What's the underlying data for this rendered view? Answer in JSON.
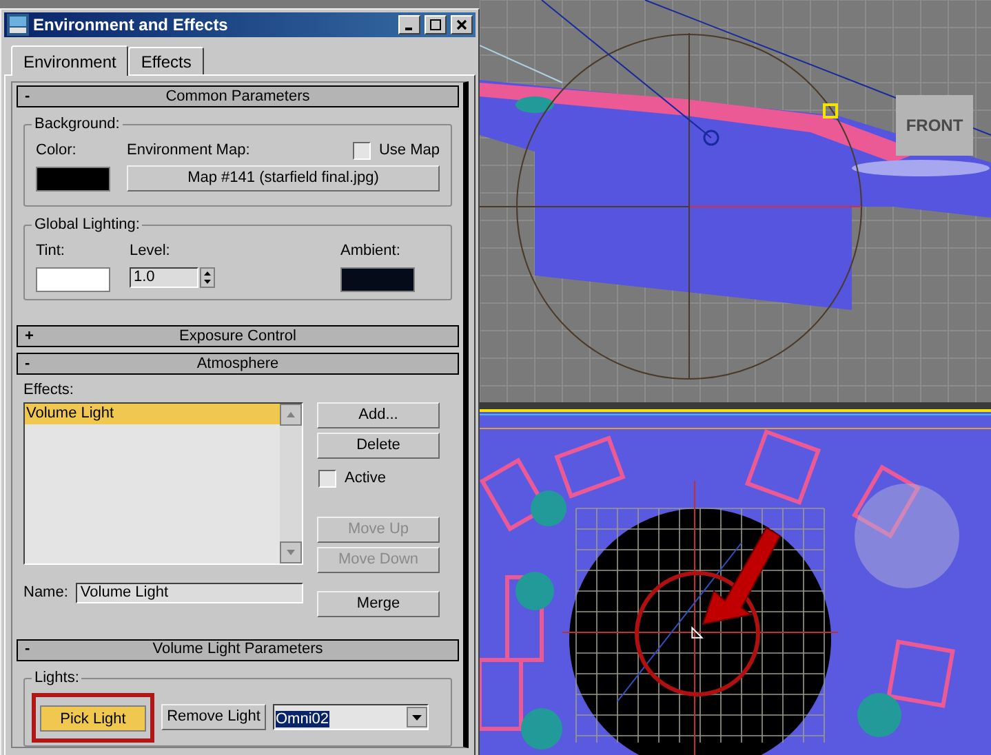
{
  "window": {
    "title": "Environment and Effects"
  },
  "tabs": [
    {
      "label": "Environment",
      "selected": true
    },
    {
      "label": "Effects",
      "selected": false
    }
  ],
  "common_parameters": {
    "toggle": "-",
    "title": "Common Parameters",
    "background": {
      "label": "Background:",
      "color_label": "Color:",
      "env_map_label": "Environment Map:",
      "use_map": {
        "label": "Use Map",
        "checked": false
      },
      "map_button": "Map #141 (starfield final.jpg)"
    },
    "global_lighting": {
      "label": "Global Lighting:",
      "tint_label": "Tint:",
      "level_label": "Level:",
      "level_value": "1.0",
      "ambient_label": "Ambient:"
    }
  },
  "exposure_control": {
    "toggle": "+",
    "title": "Exposure Control"
  },
  "atmosphere": {
    "toggle": "-",
    "title": "Atmosphere",
    "effects_label": "Effects:",
    "effects": [
      {
        "label": "Volume Light",
        "selected": true
      }
    ],
    "top_buttons": [
      {
        "label": "Add...",
        "disabled": false
      },
      {
        "label": "Delete",
        "disabled": false
      }
    ],
    "active": {
      "label": "Active",
      "checked": false
    },
    "move_buttons": [
      {
        "label": "Move Up",
        "disabled": true
      },
      {
        "label": "Move Down",
        "disabled": true
      }
    ],
    "name_label": "Name:",
    "name_value": "Volume Light",
    "merge_button": "Merge"
  },
  "volume_light_parameters": {
    "toggle": "-",
    "title": "Volume Light Parameters",
    "lights_label": "Lights:",
    "pick_light": {
      "label": "Pick Light",
      "selected": true
    },
    "remove_light": "Remove Light",
    "light_select": "Omni02"
  },
  "viewports": [
    {
      "kind": "front",
      "label": "FRONT",
      "active": false
    },
    {
      "kind": "top",
      "active": true
    }
  ]
}
